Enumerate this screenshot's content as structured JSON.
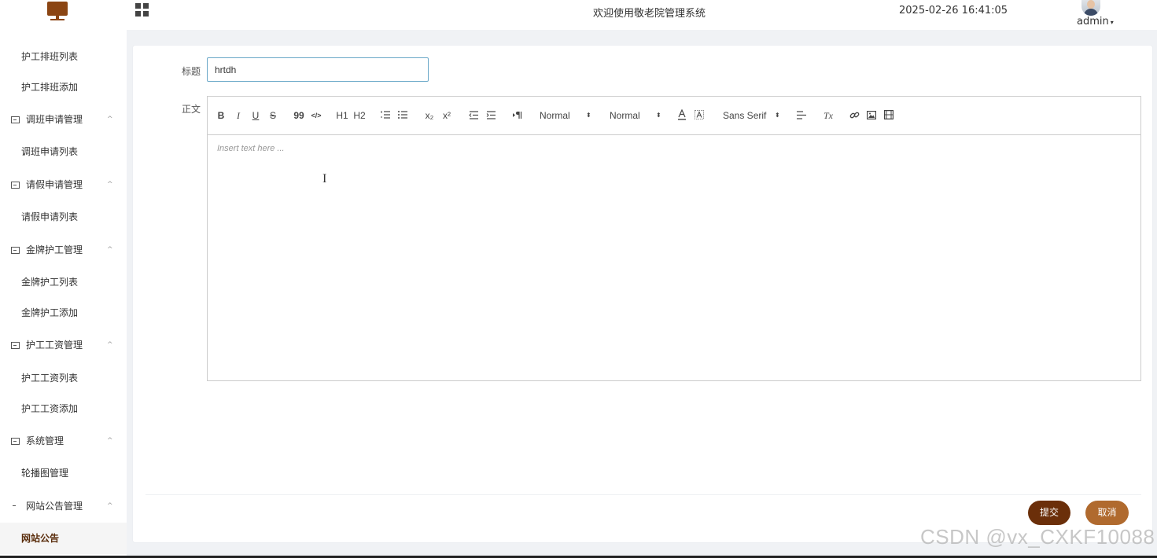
{
  "header": {
    "welcome": "欢迎使用敬老院管理系统",
    "datetime": "2025-02-26 16:41:05",
    "username": "admin",
    "caret": "▾"
  },
  "sidebar": {
    "items": [
      {
        "label": "护工排班列表",
        "type": "sub"
      },
      {
        "label": "护工排班添加",
        "type": "sub"
      },
      {
        "label": "调班申请管理",
        "type": "group"
      },
      {
        "label": "调班申请列表",
        "type": "sub"
      },
      {
        "label": "请假申请管理",
        "type": "group"
      },
      {
        "label": "请假申请列表",
        "type": "sub"
      },
      {
        "label": "金牌护工管理",
        "type": "group"
      },
      {
        "label": "金牌护工列表",
        "type": "sub"
      },
      {
        "label": "金牌护工添加",
        "type": "sub"
      },
      {
        "label": "护工工资管理",
        "type": "group"
      },
      {
        "label": "护工工资列表",
        "type": "sub"
      },
      {
        "label": "护工工资添加",
        "type": "sub"
      },
      {
        "label": "系统管理",
        "type": "group"
      },
      {
        "label": "轮播图管理",
        "type": "sub"
      },
      {
        "label": "网站公告管理",
        "type": "group"
      },
      {
        "label": "网站公告",
        "type": "sub",
        "active": true
      }
    ],
    "chevron": "^"
  },
  "form": {
    "title_label": "标题",
    "title_value": "hrtdh",
    "body_label": "正文",
    "placeholder": "Insert text here ...",
    "submit_label": "提交",
    "cancel_label": "取消"
  },
  "toolbar": {
    "bold": "B",
    "italic": "I",
    "underline": "U",
    "strike": "S",
    "blockquote": "99",
    "code": "</>",
    "h1": "H1",
    "h2": "H2",
    "subscript": "x₂",
    "superscript": "x²",
    "size_select": "Normal",
    "header_select": "Normal",
    "font_select": "Sans Serif",
    "clean": "Tx",
    "select_arrow": "⬍"
  },
  "watermark": "CSDN @vx_CXKF10088",
  "colors": {
    "brand": "#8b4513",
    "active_menu": "#5a2d0c",
    "submit": "#6b2f0a",
    "cancel": "#b06a2e",
    "input_border": "#6aa8c8"
  }
}
